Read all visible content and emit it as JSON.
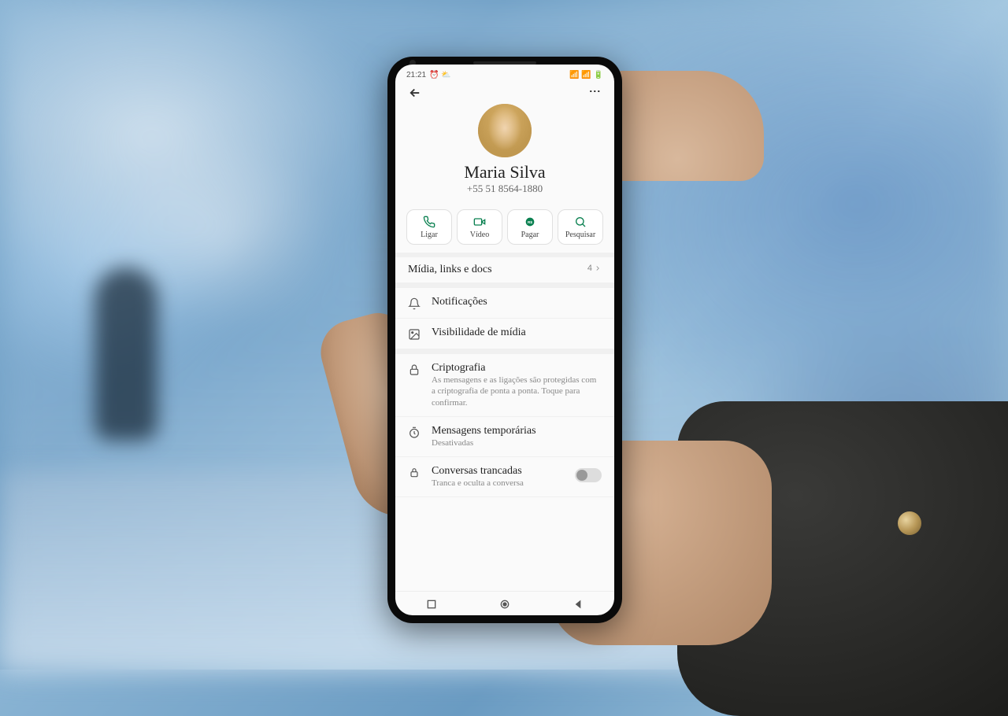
{
  "statusBar": {
    "time": "21:21",
    "icons_left": "⏰ ⛅",
    "icons_right": "📶 📶 🔋"
  },
  "contact": {
    "name": "Maria Silva",
    "phone": "+55 51 8564-1880"
  },
  "actions": {
    "call": "Ligar",
    "video": "Vídeo",
    "pay": "Pagar",
    "search": "Pesquisar"
  },
  "media": {
    "title": "Mídia, links e docs",
    "count": "4"
  },
  "settings": {
    "notifications": "Notificações",
    "media_visibility": "Visibilidade de mídia",
    "encryption_title": "Criptografia",
    "encryption_sub": "As mensagens e as ligações são protegidas com a criptografia de ponta a ponta. Toque para confirmar.",
    "disappearing_title": "Mensagens temporárias",
    "disappearing_sub": "Desativadas",
    "locked_title": "Conversas trancadas",
    "locked_sub": "Tranca e oculta a conversa"
  }
}
